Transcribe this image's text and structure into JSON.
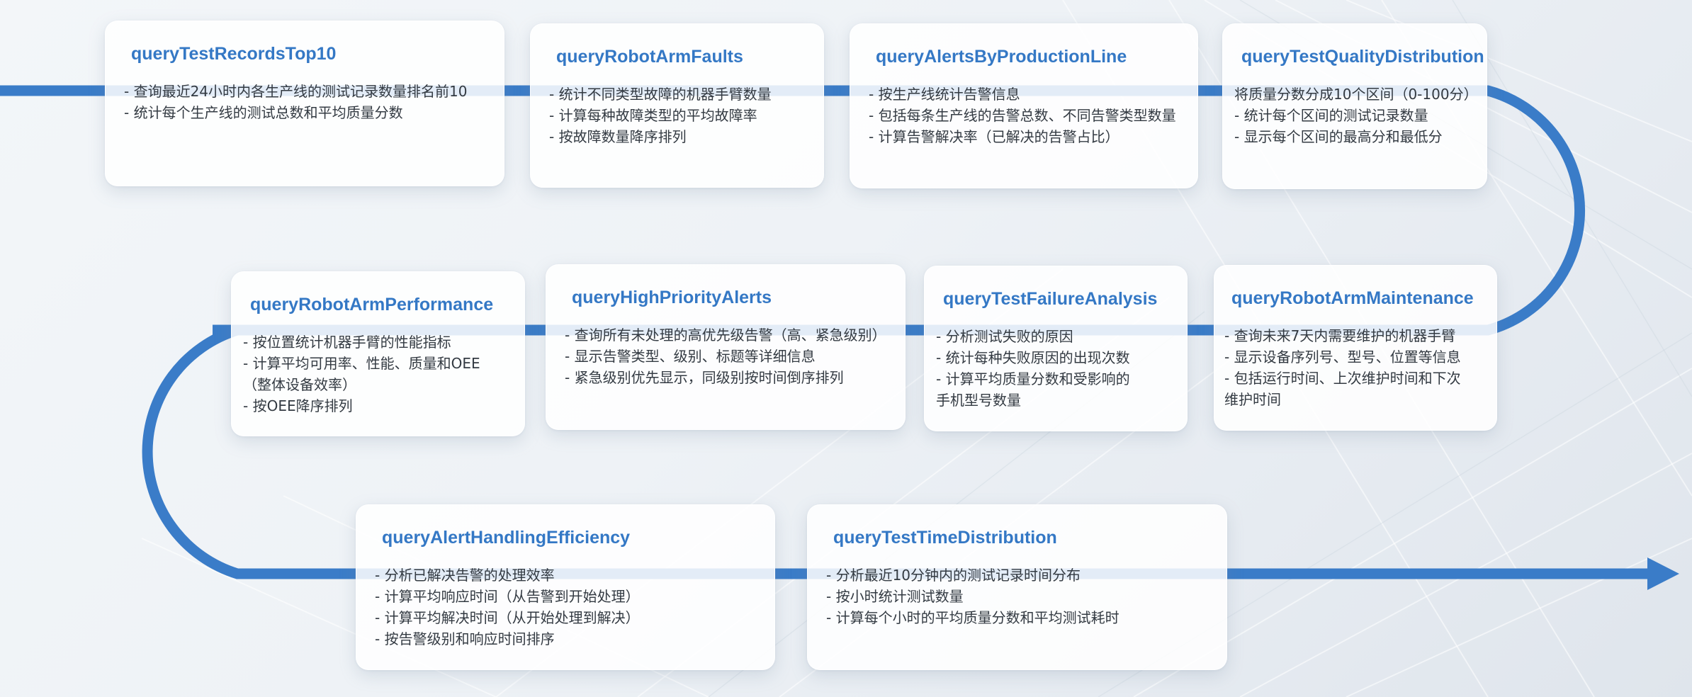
{
  "theme": {
    "flow_color": "#3a7cc8",
    "title_color": "#3478c5",
    "text_color": "#333a42"
  },
  "cards": [
    {
      "id": "query-test-records-top10",
      "title": "queryTestRecordsTop10",
      "lines": [
        "- 查询最近24小时内各生产线的测试记录数量排名前10",
        "- 统计每个生产线的测试总数和平均质量分数"
      ]
    },
    {
      "id": "query-robot-arm-faults",
      "title": "queryRobotArmFaults",
      "lines": [
        "- 统计不同类型故障的机器手臂数量",
        "- 计算每种故障类型的平均故障率",
        "- 按故障数量降序排列"
      ]
    },
    {
      "id": "query-alerts-by-production-line",
      "title": "queryAlertsByProductionLine",
      "lines": [
        "- 按生产线统计告警信息",
        "- 包括每条生产线的告警总数、不同告警类型数量",
        "- 计算告警解决率（已解决的告警占比）"
      ]
    },
    {
      "id": "query-test-quality-distribution",
      "title": "queryTestQualityDistribution",
      "lines": [
        "将质量分数分成10个区间（0-100分）",
        "- 统计每个区间的测试记录数量",
        "- 显示每个区间的最高分和最低分"
      ]
    },
    {
      "id": "query-robot-arm-performance",
      "title": "queryRobotArmPerformance",
      "lines": [
        "- 按位置统计机器手臂的性能指标",
        "- 计算平均可用率、性能、质量和OEE",
        "（整体设备效率）",
        "- 按OEE降序排列"
      ]
    },
    {
      "id": "query-high-priority-alerts",
      "title": "queryHighPriorityAlerts",
      "lines": [
        "- 查询所有未处理的高优先级告警（高、紧急级别）",
        "- 显示告警类型、级别、标题等详细信息",
        "- 紧急级别优先显示，同级别按时间倒序排列"
      ]
    },
    {
      "id": "query-test-failure-analysis",
      "title": "queryTestFailureAnalysis",
      "lines": [
        "- 分析测试失败的原因",
        "- 统计每种失败原因的出现次数",
        "- 计算平均质量分数和受影响的",
        "手机型号数量"
      ]
    },
    {
      "id": "query-robot-arm-maintenance",
      "title": "queryRobotArmMaintenance",
      "lines": [
        "- 查询未来7天内需要维护的机器手臂",
        "- 显示设备序列号、型号、位置等信息",
        "- 包括运行时间、上次维护时间和下次",
        "  维护时间"
      ]
    },
    {
      "id": "query-alert-handling-efficiency",
      "title": "queryAlertHandlingEfficiency",
      "lines": [
        "- 分析已解决告警的处理效率",
        "- 计算平均响应时间（从告警到开始处理）",
        "- 计算平均解决时间（从开始处理到解决）",
        "- 按告警级别和响应时间排序"
      ]
    },
    {
      "id": "query-test-time-distribution",
      "title": "queryTestTimeDistribution",
      "lines": [
        "- 分析最近10分钟内的测试记录时间分布",
        "- 按小时统计测试数量",
        "- 计算每个小时的平均质量分数和平均测试耗时"
      ]
    }
  ]
}
